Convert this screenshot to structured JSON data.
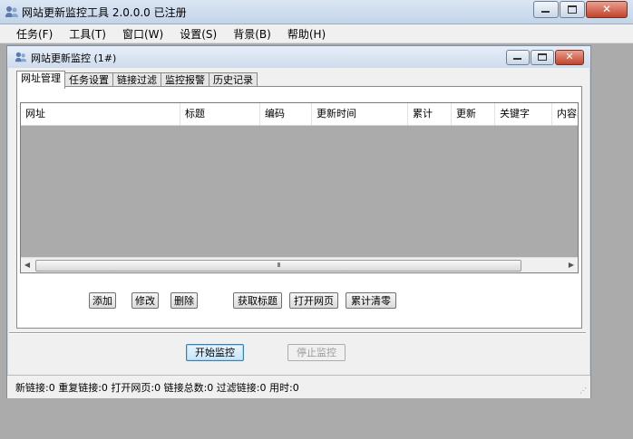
{
  "app": {
    "title": "网站更新监控工具 2.0.0.0  已注册",
    "icon": "users-icon"
  },
  "menubar": [
    "任务(F)",
    "工具(T)",
    "窗口(W)",
    "设置(S)",
    "背景(B)",
    "帮助(H)"
  ],
  "child_window": {
    "title": "网站更新监控 (1#)",
    "icon": "users-icon",
    "tabs": [
      {
        "label": "网址管理",
        "active": true
      },
      {
        "label": "任务设置",
        "active": false
      },
      {
        "label": "链接过滤",
        "active": false
      },
      {
        "label": "监控报警",
        "active": false
      },
      {
        "label": "历史记录",
        "active": false
      }
    ],
    "list_columns": [
      "网址",
      "标题",
      "编码",
      "更新时间",
      "累计",
      "更新",
      "关键字",
      "内容品"
    ],
    "scrollbar_grip": "III",
    "buttons": {
      "add": "添加",
      "edit": "修改",
      "delete": "删除",
      "get_title": "获取标题",
      "open_page": "打开网页",
      "reset_count": "累计清零"
    },
    "start_monitor": "开始监控",
    "stop_monitor": "停止监控",
    "status": "新链接:0  重复链接:0  打开网页:0  链接总数:0  过滤链接:0  用时:0"
  }
}
